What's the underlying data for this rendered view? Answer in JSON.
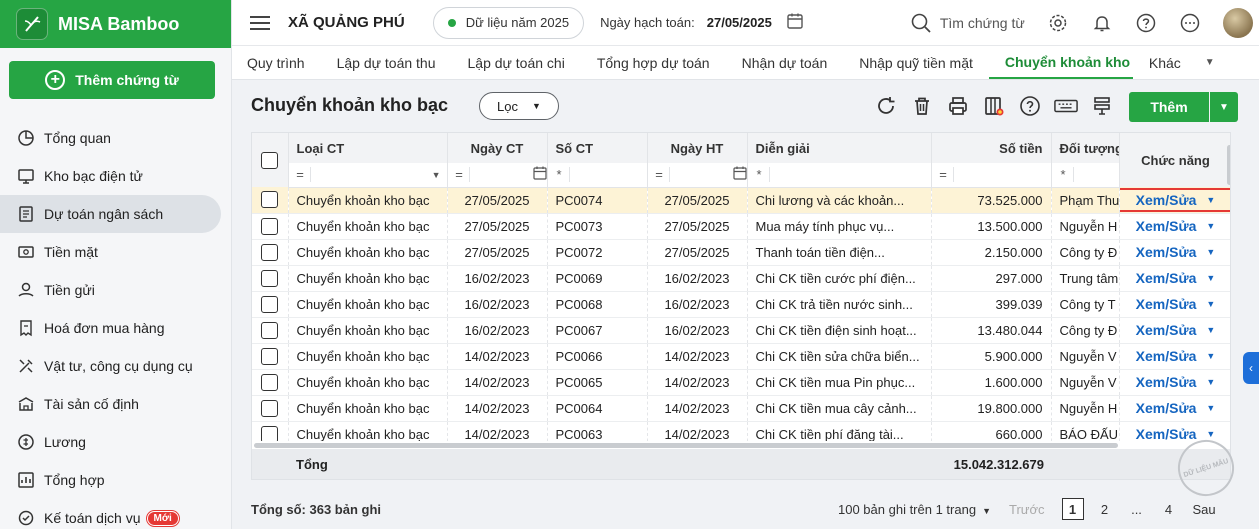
{
  "brand": {
    "name": "MISA Bamboo"
  },
  "sidebar": {
    "add_label": "Thêm chứng từ",
    "items": [
      {
        "label": "Tổng quan",
        "icon": "pie-chart-icon"
      },
      {
        "label": "Kho bạc điện tử",
        "icon": "monitor-icon"
      },
      {
        "label": "Dự toán ngân sách",
        "icon": "budget-icon",
        "active": true
      },
      {
        "label": "Tiền mặt",
        "icon": "cash-icon"
      },
      {
        "label": "Tiền gửi",
        "icon": "deposit-icon"
      },
      {
        "label": "Hoá đơn mua hàng",
        "icon": "invoice-icon"
      },
      {
        "label": "Vật tư, công cụ dụng cụ",
        "icon": "tools-icon"
      },
      {
        "label": "Tài sản cố định",
        "icon": "building-icon"
      },
      {
        "label": "Lương",
        "icon": "salary-icon"
      },
      {
        "label": "Tổng hợp",
        "icon": "summary-icon"
      },
      {
        "label": "Kế toán dịch vụ",
        "icon": "service-icon",
        "badge": "Mới"
      }
    ]
  },
  "header": {
    "org_name": "XÃ QUẢNG PHÚ",
    "data_year": "Dữ liệu năm 2025",
    "accounting_date_label": "Ngày hạch toán:",
    "accounting_date": "27/05/2025",
    "search_label": "Tìm chứng từ"
  },
  "tabs": [
    {
      "label": "Quy trình"
    },
    {
      "label": "Lập dự toán thu"
    },
    {
      "label": "Lập dự toán chi"
    },
    {
      "label": "Tổng hợp dự toán"
    },
    {
      "label": "Nhận dự toán"
    },
    {
      "label": "Nhập quỹ tiền mặt"
    },
    {
      "label": "Chuyển khoản kho bạc",
      "active": true
    }
  ],
  "tabs_more": "Khác",
  "page": {
    "title": "Chuyển khoản kho bạc",
    "filter_label": "Lọc",
    "add_label": "Thêm"
  },
  "grid": {
    "columns": {
      "type": "Loại CT",
      "date": "Ngày CT",
      "number": "Số CT",
      "posting_date": "Ngày HT",
      "description": "Diễn giải",
      "amount": "Số tiền",
      "object": "Đối tượng",
      "function": "Chức năng"
    },
    "filter_ops": {
      "eq": "=",
      "star": "*"
    },
    "action_label": "Xem/Sửa",
    "rows": [
      {
        "type": "Chuyển khoản kho bạc",
        "date": "27/05/2025",
        "number": "PC0074",
        "posting_date": "27/05/2025",
        "description": "Chi lương và các khoản...",
        "amount": "73.525.000",
        "object": "Phạm Thu",
        "selected": true
      },
      {
        "type": "Chuyển khoản kho bạc",
        "date": "27/05/2025",
        "number": "PC0073",
        "posting_date": "27/05/2025",
        "description": "Mua máy tính phục vụ...",
        "amount": "13.500.000",
        "object": "Nguyễn H"
      },
      {
        "type": "Chuyển khoản kho bạc",
        "date": "27/05/2025",
        "number": "PC0072",
        "posting_date": "27/05/2025",
        "description": "Thanh toán tiền điện...",
        "amount": "2.150.000",
        "object": "Công ty Đ"
      },
      {
        "type": "Chuyển khoản kho bạc",
        "date": "16/02/2023",
        "number": "PC0069",
        "posting_date": "16/02/2023",
        "description": "Chi CK tiền cước phí điện...",
        "amount": "297.000",
        "object": "Trung tâm"
      },
      {
        "type": "Chuyển khoản kho bạc",
        "date": "16/02/2023",
        "number": "PC0068",
        "posting_date": "16/02/2023",
        "description": "Chi CK trả tiền nước sinh...",
        "amount": "399.039",
        "object": "Công ty T"
      },
      {
        "type": "Chuyển khoản kho bạc",
        "date": "16/02/2023",
        "number": "PC0067",
        "posting_date": "16/02/2023",
        "description": "Chi CK tiền điện sinh hoạt...",
        "amount": "13.480.044",
        "object": "Công ty Đ"
      },
      {
        "type": "Chuyển khoản kho bạc",
        "date": "14/02/2023",
        "number": "PC0066",
        "posting_date": "14/02/2023",
        "description": "Chi CK tiền sửa chữa biển...",
        "amount": "5.900.000",
        "object": "Nguyễn V"
      },
      {
        "type": "Chuyển khoản kho bạc",
        "date": "14/02/2023",
        "number": "PC0065",
        "posting_date": "14/02/2023",
        "description": "Chi CK tiền mua Pin phục...",
        "amount": "1.600.000",
        "object": "Nguyễn V"
      },
      {
        "type": "Chuyển khoản kho bạc",
        "date": "14/02/2023",
        "number": "PC0064",
        "posting_date": "14/02/2023",
        "description": "Chi CK tiền mua cây cảnh...",
        "amount": "19.800.000",
        "object": "Nguyễn H"
      },
      {
        "type": "Chuyển khoản kho bạc",
        "date": "14/02/2023",
        "number": "PC0063",
        "posting_date": "14/02/2023",
        "description": "Chi CK tiền phí đăng tài...",
        "amount": "660.000",
        "object": "BÁO ĐẤU"
      }
    ],
    "total_label": "Tổng",
    "total_amount": "15.042.312.679"
  },
  "footer": {
    "total_records": "Tổng số: 363 bản ghi",
    "per_page": "100 bản ghi trên 1 trang",
    "prev": "Trước",
    "pages": [
      "1",
      "2",
      "...",
      "4"
    ],
    "next": "Sau"
  },
  "watermark": "DỮ LIỆU MẪU",
  "colors": {
    "primary": "#26a544",
    "link": "#1565c0",
    "highlight_border": "#e53935",
    "selected_row": "#fdf3d6"
  }
}
